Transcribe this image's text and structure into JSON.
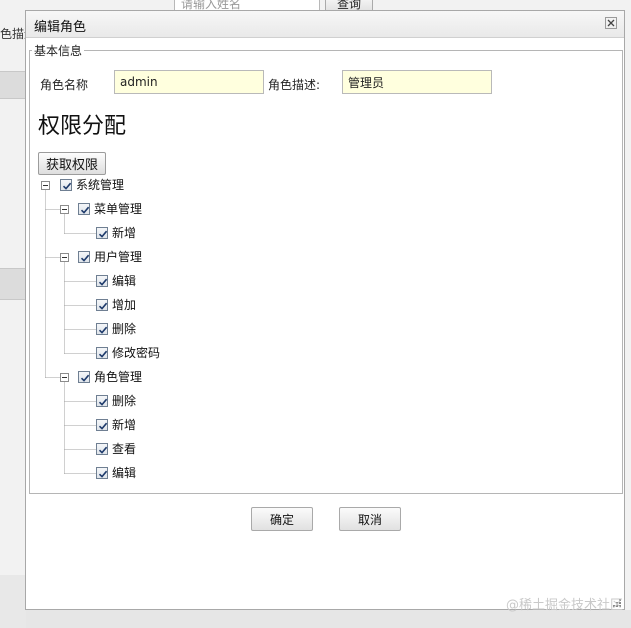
{
  "background": {
    "search_placeholder": "请输入姓名",
    "query_button": "查询",
    "left_column_label": "色描述"
  },
  "dialog": {
    "title": "编辑角色",
    "close_icon": "close-icon",
    "fieldset_legend": "基本信息",
    "role_name_label": "角色名称",
    "role_name_value": "admin",
    "role_desc_label": "角色描述:",
    "role_desc_value": "管理员",
    "section_heading": "权限分配",
    "get_permissions_button": "获取权限",
    "ok_button": "确定",
    "cancel_button": "取消"
  },
  "tree": {
    "root": {
      "label": "系统管理",
      "checked": true,
      "expanded": true
    },
    "groups": [
      {
        "label": "菜单管理",
        "checked": true,
        "expanded": true,
        "children": [
          {
            "label": "新增",
            "checked": true
          }
        ]
      },
      {
        "label": "用户管理",
        "checked": true,
        "expanded": true,
        "children": [
          {
            "label": "编辑",
            "checked": true
          },
          {
            "label": "增加",
            "checked": true
          },
          {
            "label": "删除",
            "checked": true
          },
          {
            "label": "修改密码",
            "checked": true
          }
        ]
      },
      {
        "label": "角色管理",
        "checked": true,
        "expanded": true,
        "children": [
          {
            "label": "删除",
            "checked": true
          },
          {
            "label": "新增",
            "checked": true
          },
          {
            "label": "查看",
            "checked": true
          },
          {
            "label": "编辑",
            "checked": true
          }
        ]
      }
    ]
  },
  "watermark": "@稀土掘金技术社区",
  "colors": {
    "input_background": "#ffffde",
    "dialog_border": "#a8a8a8",
    "tree_line": "#a0a0a0"
  }
}
